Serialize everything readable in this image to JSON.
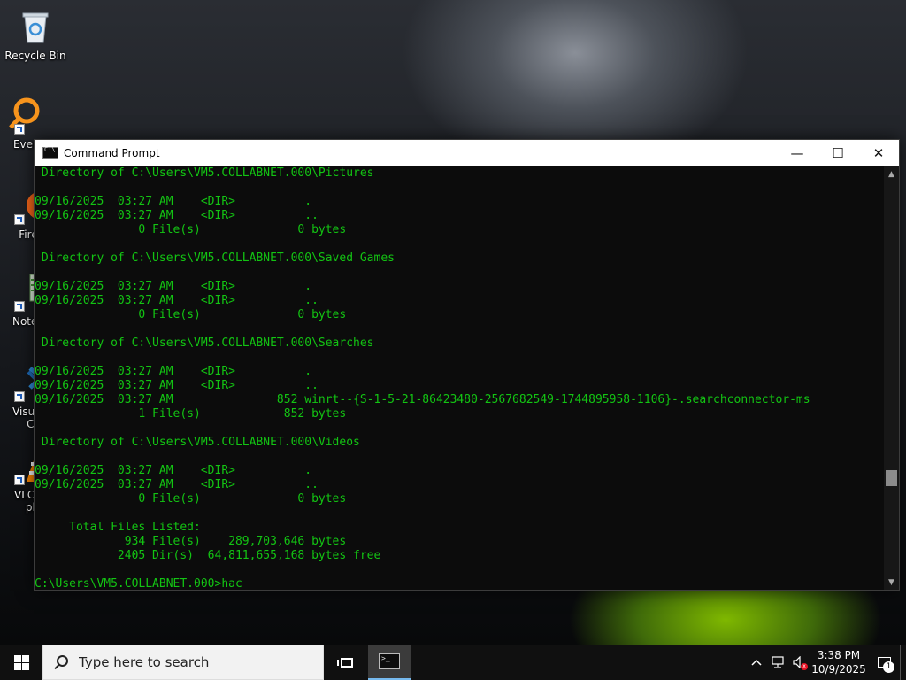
{
  "desktop": {
    "icons": [
      {
        "label": "Recycle Bin",
        "icon": "recycle-bin-icon"
      },
      {
        "label": "Every",
        "icon": "everything-search-icon"
      },
      {
        "label": "Fire",
        "icon": "firefox-icon"
      },
      {
        "label": "Notep",
        "icon": "notepad-icon"
      },
      {
        "label": "Visual",
        "label2": "Co",
        "icon": "vscode-icon"
      },
      {
        "label": "VLC r",
        "label2": "pla",
        "icon": "vlc-icon"
      }
    ]
  },
  "window": {
    "title": "Command Prompt",
    "minimize": "—",
    "maximize": "☐",
    "close": "✕",
    "console_color": "#13c413",
    "lines": [
      " Directory of C:\\Users\\VM5.COLLABNET.000\\Pictures",
      "",
      "09/16/2025  03:27 AM    <DIR>          .",
      "09/16/2025  03:27 AM    <DIR>          ..",
      "               0 File(s)              0 bytes",
      "",
      " Directory of C:\\Users\\VM5.COLLABNET.000\\Saved Games",
      "",
      "09/16/2025  03:27 AM    <DIR>          .",
      "09/16/2025  03:27 AM    <DIR>          ..",
      "               0 File(s)              0 bytes",
      "",
      " Directory of C:\\Users\\VM5.COLLABNET.000\\Searches",
      "",
      "09/16/2025  03:27 AM    <DIR>          .",
      "09/16/2025  03:27 AM    <DIR>          ..",
      "09/16/2025  03:27 AM               852 winrt--{S-1-5-21-86423480-2567682549-1744895958-1106}-.searchconnector-ms",
      "               1 File(s)            852 bytes",
      "",
      " Directory of C:\\Users\\VM5.COLLABNET.000\\Videos",
      "",
      "09/16/2025  03:27 AM    <DIR>          .",
      "09/16/2025  03:27 AM    <DIR>          ..",
      "               0 File(s)              0 bytes",
      "",
      "     Total Files Listed:",
      "             934 File(s)    289,703,646 bytes",
      "            2405 Dir(s)  64,811,655,168 bytes free",
      "",
      "C:\\Users\\VM5.COLLABNET.000>hac"
    ]
  },
  "taskbar": {
    "search_placeholder": "Type here to search",
    "time": "3:38 PM",
    "date": "10/9/2025",
    "notification_count": "1",
    "mute_mark": "x"
  }
}
